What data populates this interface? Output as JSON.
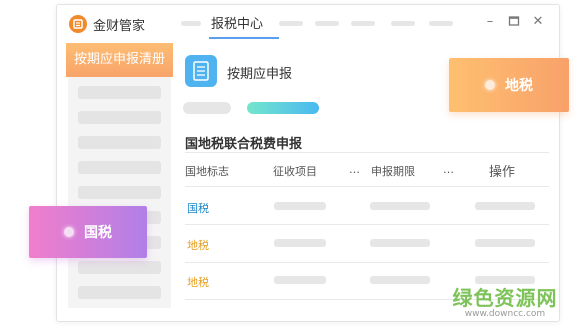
{
  "titlebar": {
    "app_title": "金财管家",
    "active_tab": "报税中心",
    "controls": [
      "minimize-icon",
      "maximize-icon",
      "close-icon"
    ]
  },
  "sidebar": {
    "header": "按期应申报清册"
  },
  "card": {
    "title": "按期应申报",
    "icon": "document-icon"
  },
  "section": {
    "title": "国地税联合税费申报"
  },
  "table": {
    "columns": [
      "国地标志",
      "征收项目",
      "…",
      "申报期限",
      "…",
      "操作"
    ],
    "rows": [
      {
        "flag": "国税"
      },
      {
        "flag": "地税"
      },
      {
        "flag": "地税"
      }
    ]
  },
  "badges": {
    "local": "地税",
    "national": "国税"
  },
  "watermark": {
    "text": "绿色资源网",
    "url": "www.downcc.com"
  },
  "colors": {
    "accent_blue": "#1e87c8",
    "accent_orange": "#e8a024",
    "sidebar_header": "#f8a46a",
    "badge_local": "#fbb06e",
    "badge_national": "#d07fdc"
  }
}
